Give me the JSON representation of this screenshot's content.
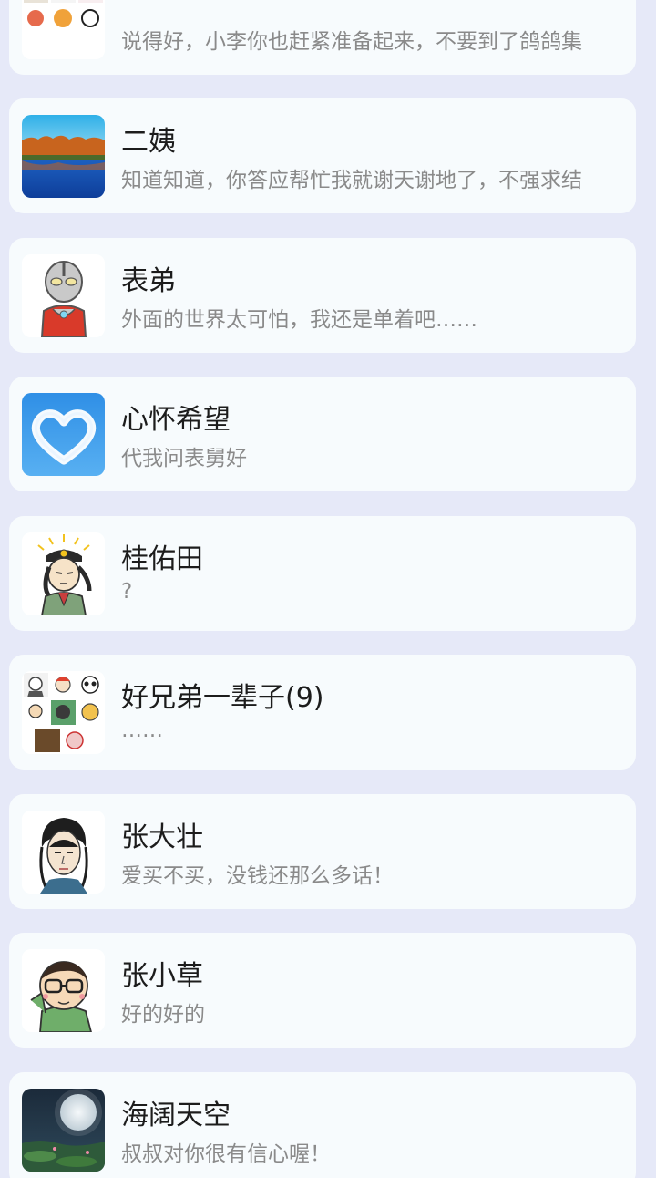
{
  "chats": [
    {
      "avatar": "group-grid-avatar",
      "name": "",
      "message": "说得好，小李你也赶紧准备起来，不要到了鸽鸽集"
    },
    {
      "avatar": "autumn-lake-avatar",
      "name": "二姨",
      "message": "知道知道，你答应帮忙我就谢天谢地了，不强求结"
    },
    {
      "avatar": "ultraman-avatar",
      "name": "表弟",
      "message": "外面的世界太可怕，我还是单着吧……"
    },
    {
      "avatar": "cloud-heart-avatar",
      "name": "心怀希望",
      "message": "代我问表舅好"
    },
    {
      "avatar": "cartoon-monk-avatar",
      "name": "桂佑田",
      "message": "?"
    },
    {
      "avatar": "group-grid-avatar",
      "name": "好兄弟一辈子(9)",
      "message": "……"
    },
    {
      "avatar": "anime-man-avatar",
      "name": "张大壮",
      "message": "爱买不买，没钱还那么多话！"
    },
    {
      "avatar": "cartoon-glasses-avatar",
      "name": "张小草",
      "message": "好的好的"
    },
    {
      "avatar": "moon-night-avatar",
      "name": "海阔天空",
      "message": "叔叔对你很有信心喔！"
    }
  ],
  "colors": {
    "background": "#e6e9f8",
    "card": "#f7fbfd",
    "name_text": "#1c1c1c",
    "message_text": "#8a8a8a"
  }
}
